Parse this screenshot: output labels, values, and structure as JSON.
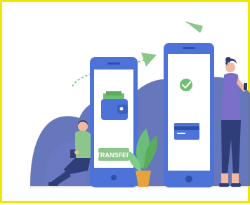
{
  "illustration": {
    "transfer_label": "TRANSFER"
  },
  "colors": {
    "frame_border": "#f2e600",
    "background": "#ffffff",
    "blob_shadow": "#5a6bb5",
    "phone_body": "#4d73d9",
    "phone_screen": "#ffffff",
    "wallet": "#4d73d9",
    "cash": "#6fbf73",
    "check_circle": "#6fbf73",
    "transfer_button": "#8cc68a",
    "plant_leaf": "#6bbd79",
    "pot": "#e8a23c",
    "arrow": "#8cc68a",
    "person_shirt_left": "#8cc68a",
    "person_shirt_right": "#7b6fc9",
    "person_pants": "#2f3e78"
  },
  "icons": [
    "wallet-icon",
    "checkmark-icon",
    "credit-card-icon",
    "arrow-icon",
    "plant-icon"
  ]
}
